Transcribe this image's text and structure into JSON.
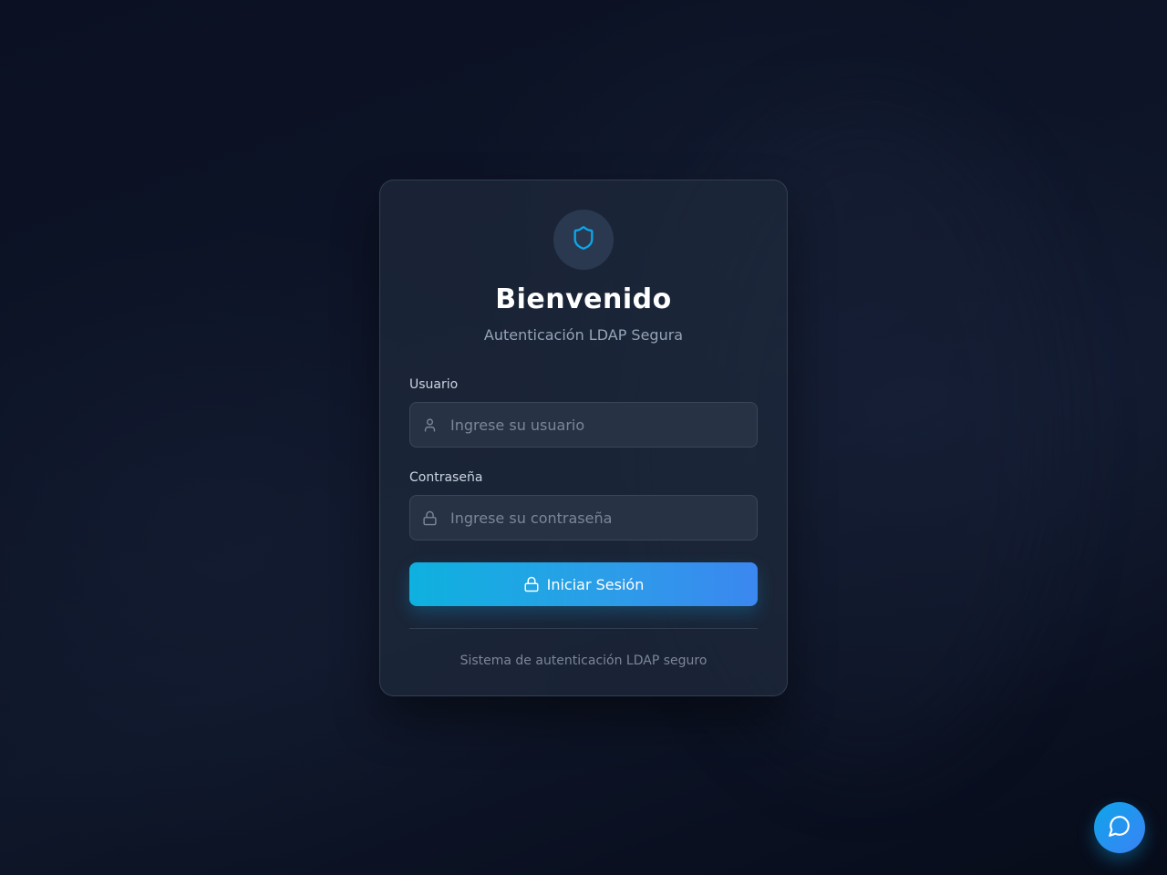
{
  "login": {
    "title": "Bienvenido",
    "subtitle": "Autenticación LDAP Segura",
    "username": {
      "label": "Usuario",
      "placeholder": "Ingrese su usuario",
      "value": "",
      "icon": "user-icon"
    },
    "password": {
      "label": "Contraseña",
      "placeholder": "Ingrese su contraseña",
      "value": "",
      "icon": "lock-icon"
    },
    "submit_label": "Iniciar Sesión",
    "submit_icon": "lock-icon",
    "footer": "Sistema de autenticación LDAP seguro",
    "logo_icon": "shield-icon"
  },
  "chat": {
    "icon": "chat-bubble-icon"
  },
  "colors": {
    "accent": "#0ea5e9",
    "accent_secondary": "#3b82f6",
    "background": "#0f172a",
    "card": "#1e293b",
    "title": "#ffffff",
    "muted": "#94a3b8"
  }
}
